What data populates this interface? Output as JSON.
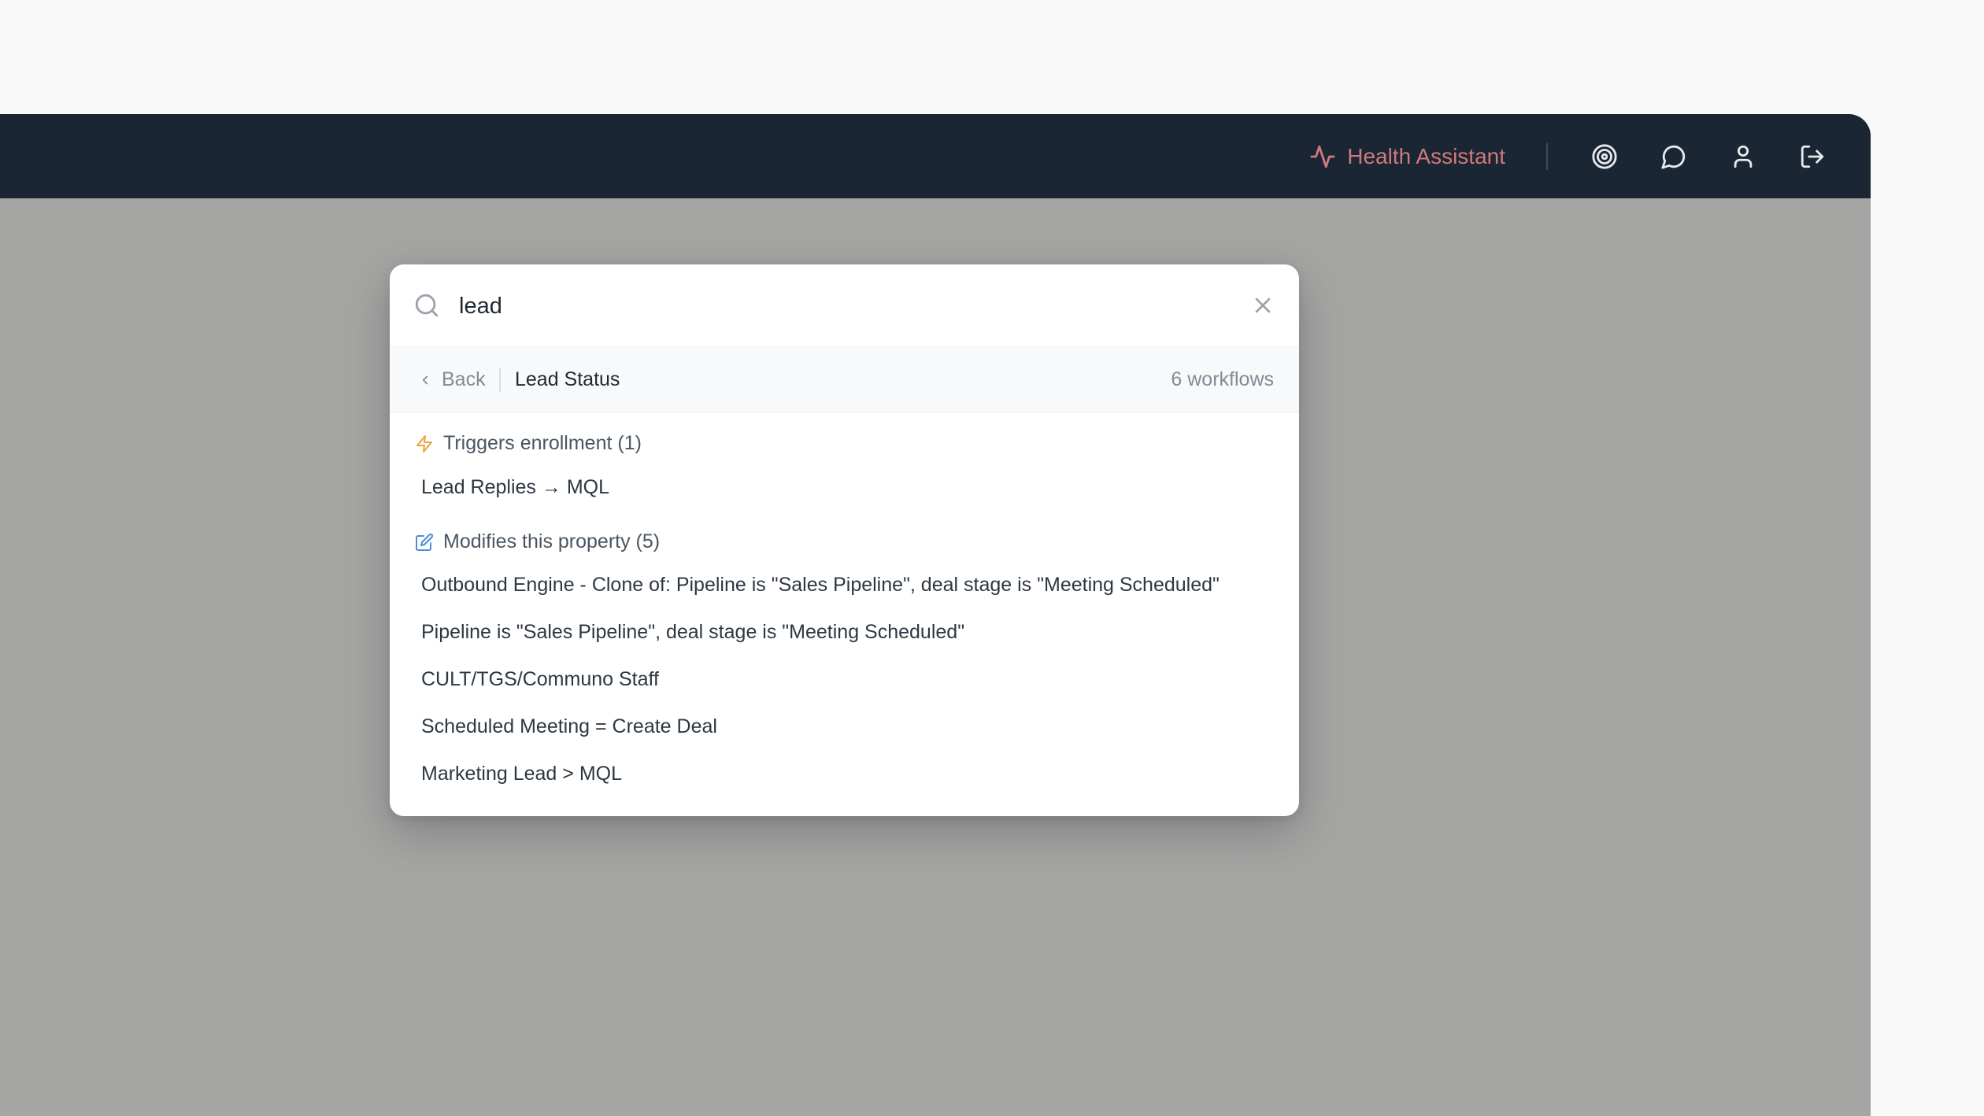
{
  "topbar": {
    "health_assistant_label": "Health Assistant",
    "icons": [
      "activity-icon",
      "target-icon",
      "chat-icon",
      "user-icon",
      "logout-icon"
    ]
  },
  "search": {
    "value": "lead"
  },
  "subheader": {
    "back_label": "Back",
    "title": "Lead Status",
    "count": "6 workflows"
  },
  "sections": {
    "triggers": {
      "label": "Triggers enrollment (1)",
      "items": [
        "Lead Replies → MQL"
      ]
    },
    "modifies": {
      "label": "Modifies this property (5)",
      "items": [
        "Outbound Engine - Clone of: Pipeline is \"Sales Pipeline\", deal stage is \"Meeting Scheduled\"",
        "Pipeline is \"Sales Pipeline\", deal stage is \"Meeting Scheduled\"",
        "CULT/TGS/Communo Staff",
        "Scheduled Meeting = Create Deal",
        "Marketing Lead > MQL"
      ]
    }
  },
  "colors": {
    "topbar_bg": "#1a2634",
    "overlay_bg": "#a5a5a4",
    "health_accent": "#d0797a",
    "trigger_icon": "#f0a33a",
    "modify_icon": "#4a8ed8"
  }
}
